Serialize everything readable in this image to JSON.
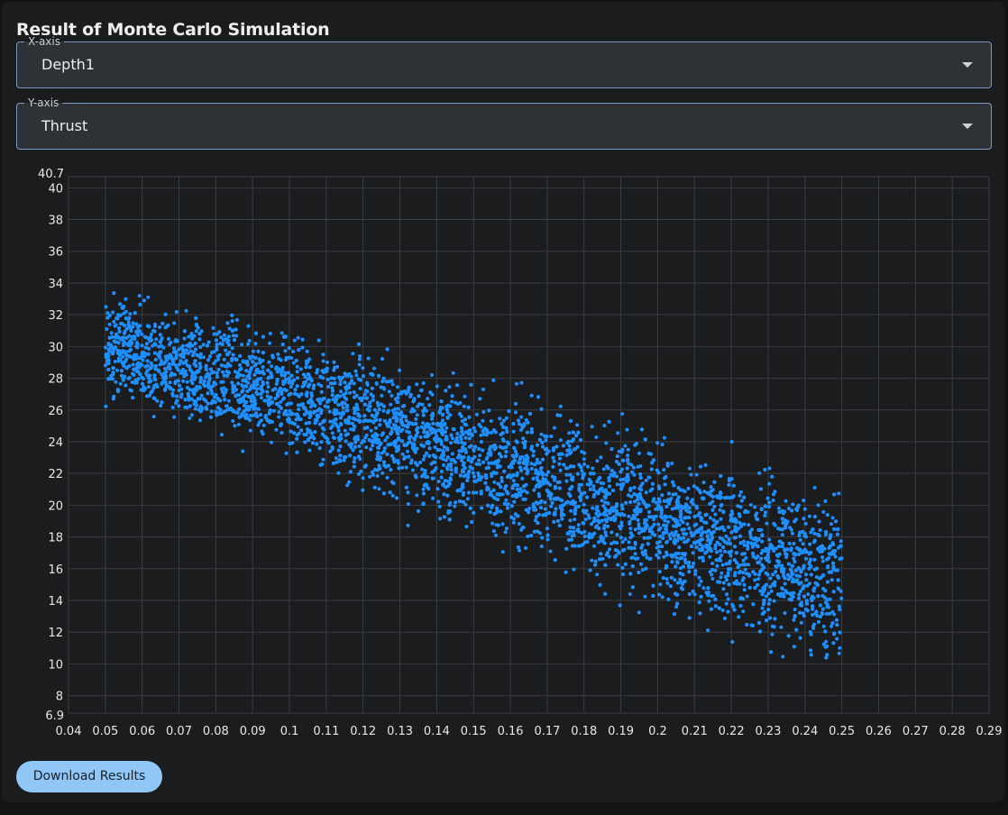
{
  "page": {
    "title": "Result of Monte Carlo Simulation"
  },
  "x_select": {
    "label": "X-axis",
    "value": "Depth1"
  },
  "y_select": {
    "label": "Y-axis",
    "value": "Thrust"
  },
  "download_button": {
    "label": "Download Results"
  },
  "colors": {
    "point": "#1e8fff",
    "grid": "#3a3d42",
    "tick": "#e8e8e8",
    "accent": "#90c7f7"
  },
  "chart_data": {
    "type": "scatter",
    "title": "",
    "xlabel": "",
    "ylabel": "",
    "xlim": [
      0.04,
      0.29
    ],
    "ylim": [
      6.9,
      40.7
    ],
    "x_ticks": [
      "0.04",
      "0.05",
      "0.06",
      "0.07",
      "0.08",
      "0.09",
      "0.1",
      "0.11",
      "0.12",
      "0.13",
      "0.14",
      "0.15",
      "0.16",
      "0.17",
      "0.18",
      "0.19",
      "0.2",
      "0.21",
      "0.22",
      "0.23",
      "0.24",
      "0.25",
      "0.26",
      "0.27",
      "0.28",
      "0.29"
    ],
    "y_ticks": [
      "6.9",
      "8",
      "10",
      "12",
      "14",
      "16",
      "18",
      "20",
      "22",
      "24",
      "26",
      "28",
      "30",
      "32",
      "34",
      "36",
      "38",
      "40",
      "40.7"
    ],
    "grid": true,
    "series": [
      {
        "point_count": 6000,
        "x_range": [
          0.05,
          0.25
        ],
        "trend": {
          "upper_edge": [
            [
              0.05,
              34.0
            ],
            [
              0.1,
              32.0
            ],
            [
              0.15,
              29.0
            ],
            [
              0.2,
              26.0
            ],
            [
              0.25,
              22.0
            ]
          ],
          "lower_edge": [
            [
              0.05,
              25.8
            ],
            [
              0.1,
              22.0
            ],
            [
              0.15,
              17.0
            ],
            [
              0.2,
              12.0
            ],
            [
              0.25,
              8.2
            ]
          ]
        },
        "y_min_observed": 8.1,
        "y_max_observed": 35.4
      }
    ]
  }
}
